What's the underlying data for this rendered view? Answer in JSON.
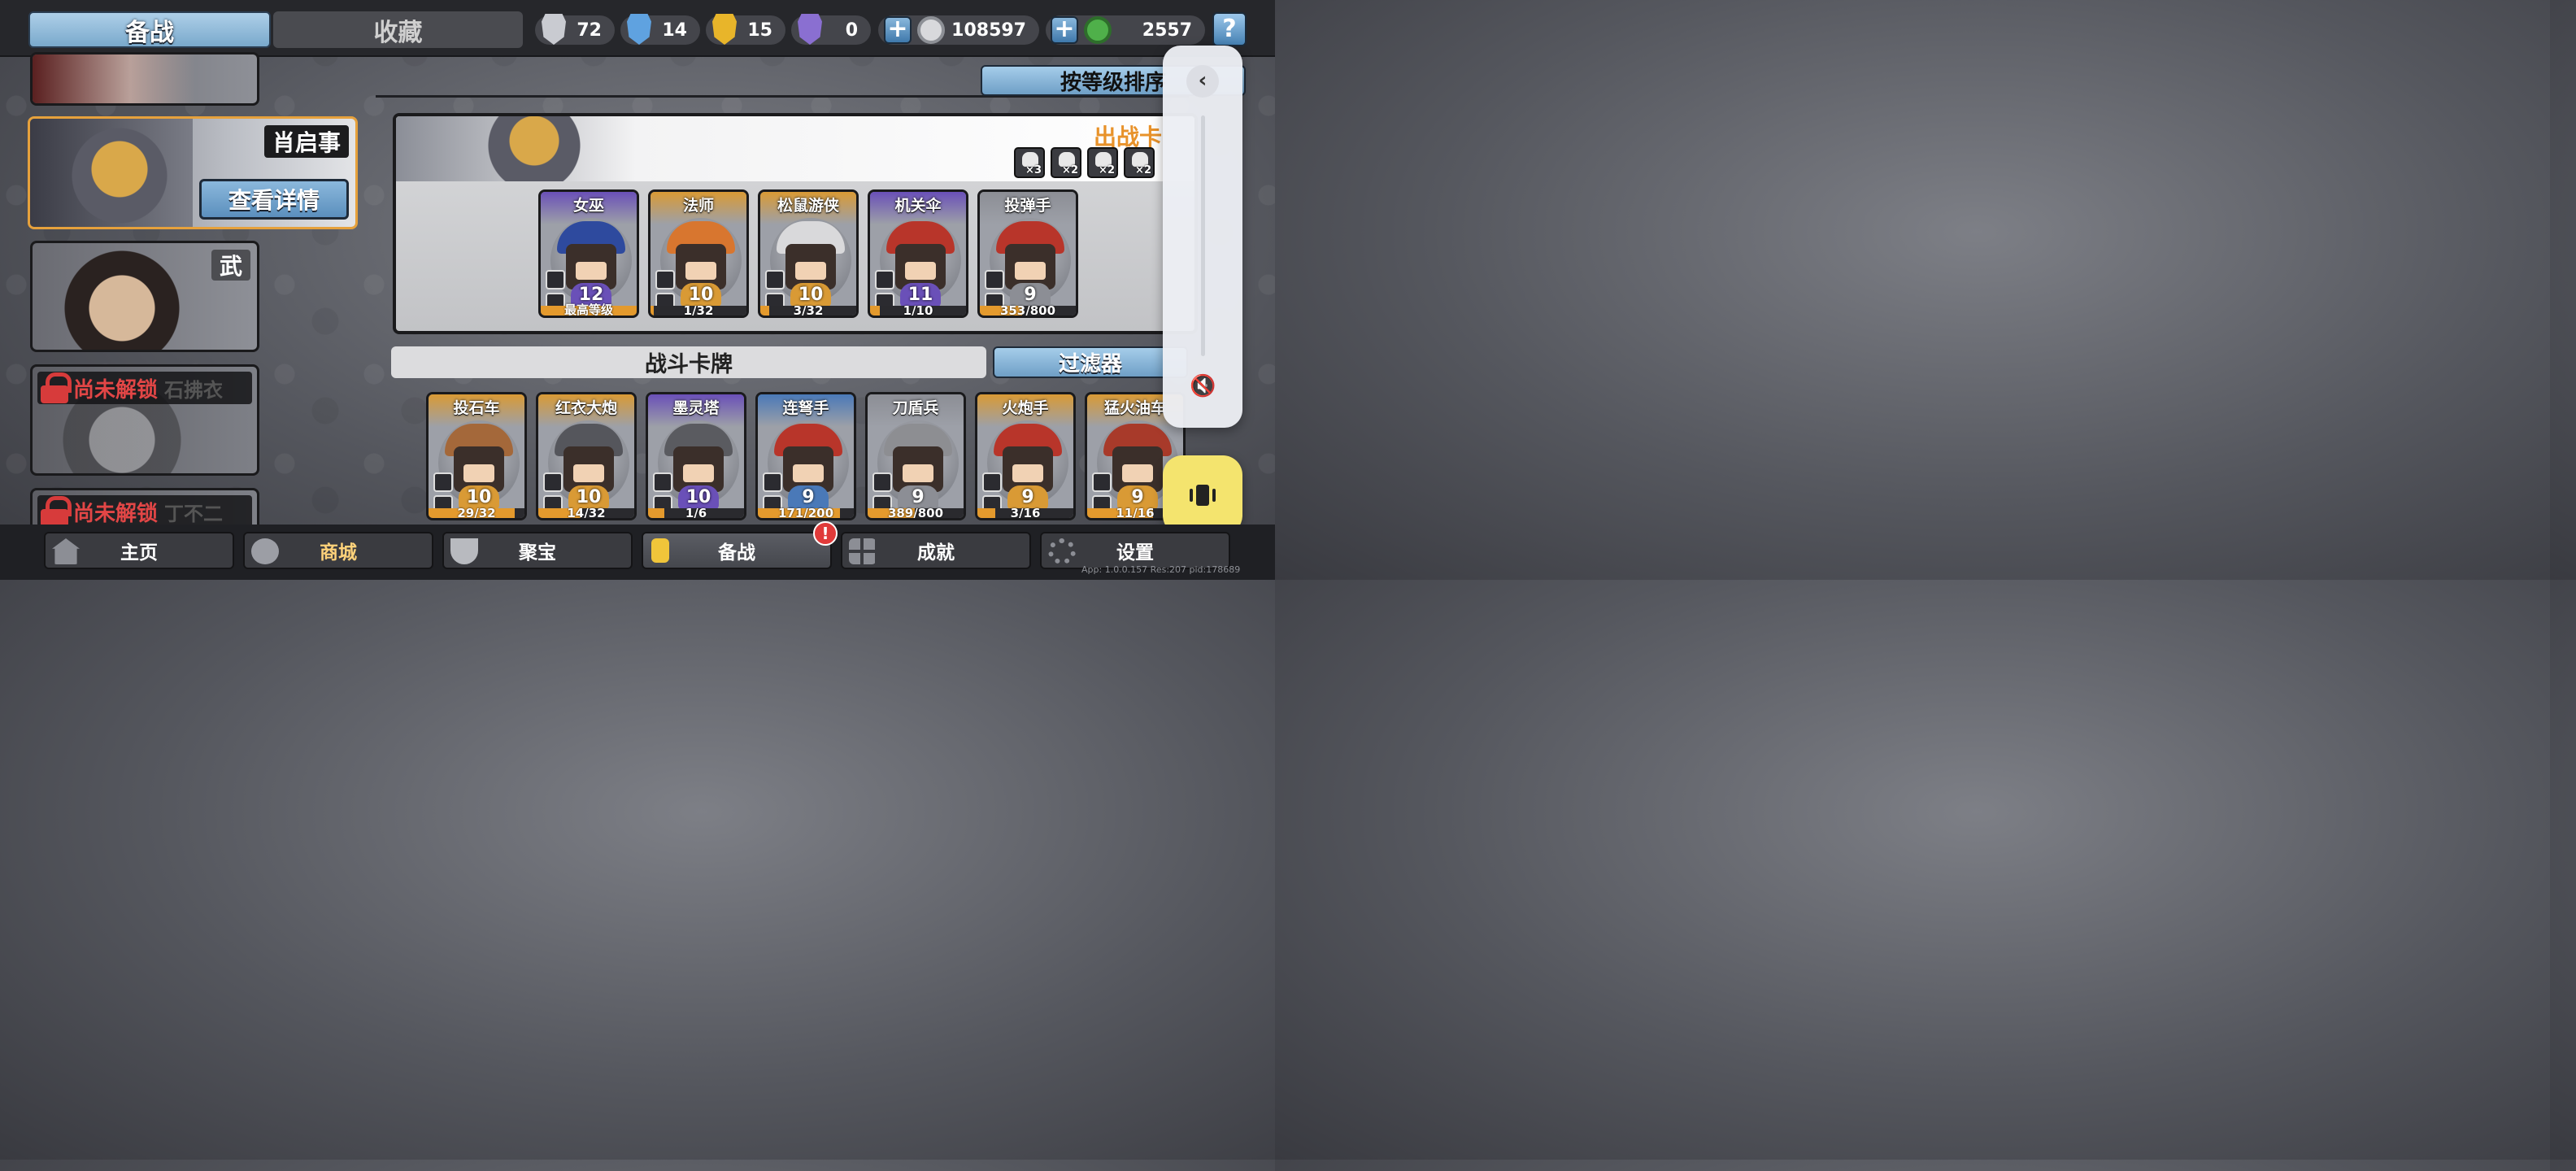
{
  "top_tabs": {
    "prep": "备战",
    "collection": "收藏"
  },
  "resources": [
    {
      "icon": "silver-shield-icon",
      "value": "72",
      "color": "#c9cbd1"
    },
    {
      "icon": "blue-crystal-shield-icon",
      "value": "14",
      "color": "#5fa2e0"
    },
    {
      "icon": "gold-shield-icon",
      "value": "15",
      "color": "#e8b52a"
    },
    {
      "icon": "purple-shield-icon",
      "value": "0",
      "color": "#8a6fd1"
    }
  ],
  "silver_coin": "108597",
  "jade_coin": "2557",
  "commanders": [
    {
      "name": "",
      "state": "partial"
    },
    {
      "name": "肖启事",
      "state": "selected",
      "detail_button": "查看详情"
    },
    {
      "name": "武",
      "state": "normal"
    },
    {
      "name": "石拂衣",
      "state": "locked",
      "lock_label": "尚未解锁"
    },
    {
      "name": "丁不二",
      "state": "locked",
      "lock_label": "尚未解锁"
    }
  ],
  "sort_button": "按等级排序",
  "deck": {
    "title": "出战卡",
    "traits": [
      "×3",
      "×2",
      "×2",
      "×2"
    ],
    "cards": [
      {
        "name": "女巫",
        "level": "12",
        "progress": "最高等级",
        "progress_fraction": 1.0,
        "rarity_color": "#6a50b8",
        "hat_color": "#2e4a9e"
      },
      {
        "name": "法师",
        "level": "10",
        "progress": "1/32",
        "progress_fraction": 0.03,
        "rarity_color": "#d99a35",
        "hat_color": "#d8762f"
      },
      {
        "name": "松鼠游侠",
        "level": "10",
        "progress": "3/32",
        "progress_fraction": 0.09,
        "rarity_color": "#d99a35",
        "hat_color": "#d9d9db"
      },
      {
        "name": "机关伞",
        "level": "11",
        "progress": "1/10",
        "progress_fraction": 0.1,
        "rarity_color": "#6a50b8",
        "hat_color": "#b8352a"
      },
      {
        "name": "投弹手",
        "level": "9",
        "progress": "353/800",
        "progress_fraction": 0.44,
        "rarity_color": "#8c8e95",
        "hat_color": "#b8352a"
      }
    ]
  },
  "battle_cards_title": "战斗卡牌",
  "filter_button": "过滤器",
  "battle_cards": [
    {
      "name": "投石车",
      "level": "10",
      "progress": "29/32",
      "progress_fraction": 0.9,
      "rarity_color": "#d99a35",
      "hat_color": "#a4683a"
    },
    {
      "name": "红衣大炮",
      "level": "10",
      "progress": "14/32",
      "progress_fraction": 0.44,
      "rarity_color": "#d99a35",
      "hat_color": "#55565c"
    },
    {
      "name": "墨灵塔",
      "level": "10",
      "progress": "1/6",
      "progress_fraction": 0.17,
      "rarity_color": "#6a50b8",
      "hat_color": "#5a5b60"
    },
    {
      "name": "连弩手",
      "level": "9",
      "progress": "171/200",
      "progress_fraction": 0.86,
      "rarity_color": "#4a79b8",
      "hat_color": "#b8352a"
    },
    {
      "name": "刀盾兵",
      "level": "9",
      "progress": "389/800",
      "progress_fraction": 0.49,
      "rarity_color": "#8c8e95",
      "hat_color": "#8d8e92"
    },
    {
      "name": "火炮手",
      "level": "9",
      "progress": "3/16",
      "progress_fraction": 0.19,
      "rarity_color": "#d99a35",
      "hat_color": "#b8352a"
    },
    {
      "name": "猛火油车",
      "level": "9",
      "progress": "11/16",
      "progress_fraction": 0.69,
      "rarity_color": "#d99a35",
      "hat_color": "#a83a2a"
    }
  ],
  "bottom_nav": [
    {
      "label": "主页",
      "icon": "pagoda-icon"
    },
    {
      "label": "商城",
      "icon": "coins-icon"
    },
    {
      "label": "聚宝",
      "icon": "treasure-bowl-icon"
    },
    {
      "label": "备战",
      "icon": "cards-icon"
    },
    {
      "label": "成就",
      "icon": "achievement-grid-icon"
    },
    {
      "label": "设置",
      "icon": "gear-icon"
    }
  ],
  "alert_badge": "!",
  "version_text": "App: 1.0.0.157 Res:207 pid:178689"
}
